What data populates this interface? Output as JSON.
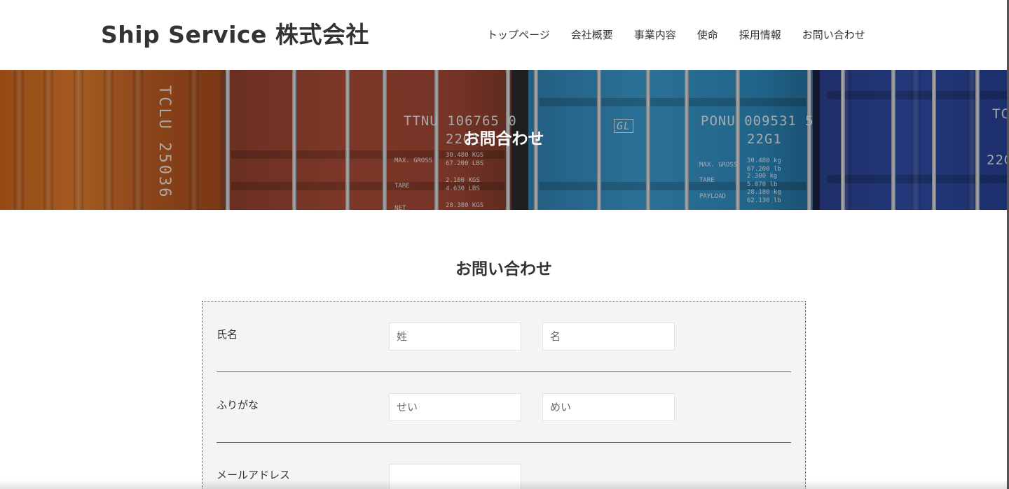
{
  "header": {
    "logo": "Ship Service 株式会社",
    "nav": [
      {
        "label": "トップページ"
      },
      {
        "label": "会社概要"
      },
      {
        "label": "事業内容"
      },
      {
        "label": "使命"
      },
      {
        "label": "採用情報"
      },
      {
        "label": "お問い合わせ"
      }
    ]
  },
  "hero": {
    "title": "お問合わせ",
    "container_marks": {
      "red_code": "TTNU  106765 0",
      "red_type": "22G1",
      "red_max_gross": "MAX. GROSS",
      "red_max_gross_values": "30.480 KGS\n67.200 LBS",
      "red_tare": "TARE",
      "red_tare_values": "2.100 KGS\n4.630 LBS",
      "red_net": "NET",
      "red_net_values": "28.380 KGS",
      "cyan_code": "PONU  009531 5",
      "cyan_type": "22G1",
      "cyan_logo": "GL",
      "cyan_max_gross": "MAX. GROSS",
      "cyan_max_gross_values": "30.480 kg\n67.200 lb",
      "cyan_tare": "TARE",
      "cyan_tare_values": "2.300 kg\n5.070 lb",
      "cyan_payload": "PAYLOAD",
      "cyan_payload_values": "28.180 kg\n62.130 lb",
      "orange_code": "TCLU 25036",
      "blue_code": "TC",
      "blue_type": "22G"
    }
  },
  "main": {
    "section_title": "お問い合わせ",
    "form": {
      "rows": [
        {
          "label": "氏名",
          "inputs": [
            {
              "placeholder": "姓",
              "value": ""
            },
            {
              "placeholder": "名",
              "value": ""
            }
          ]
        },
        {
          "label": "ふりがな",
          "inputs": [
            {
              "placeholder": "せい",
              "value": ""
            },
            {
              "placeholder": "めい",
              "value": ""
            }
          ]
        },
        {
          "label": "メールアドレス",
          "inputs": [
            {
              "placeholder": "",
              "value": ""
            }
          ]
        }
      ]
    }
  },
  "colors": {
    "text": "#333333",
    "form_bg": "#f4f4f4",
    "hero_overlay": "rgba(0,0,0,0.25)"
  }
}
